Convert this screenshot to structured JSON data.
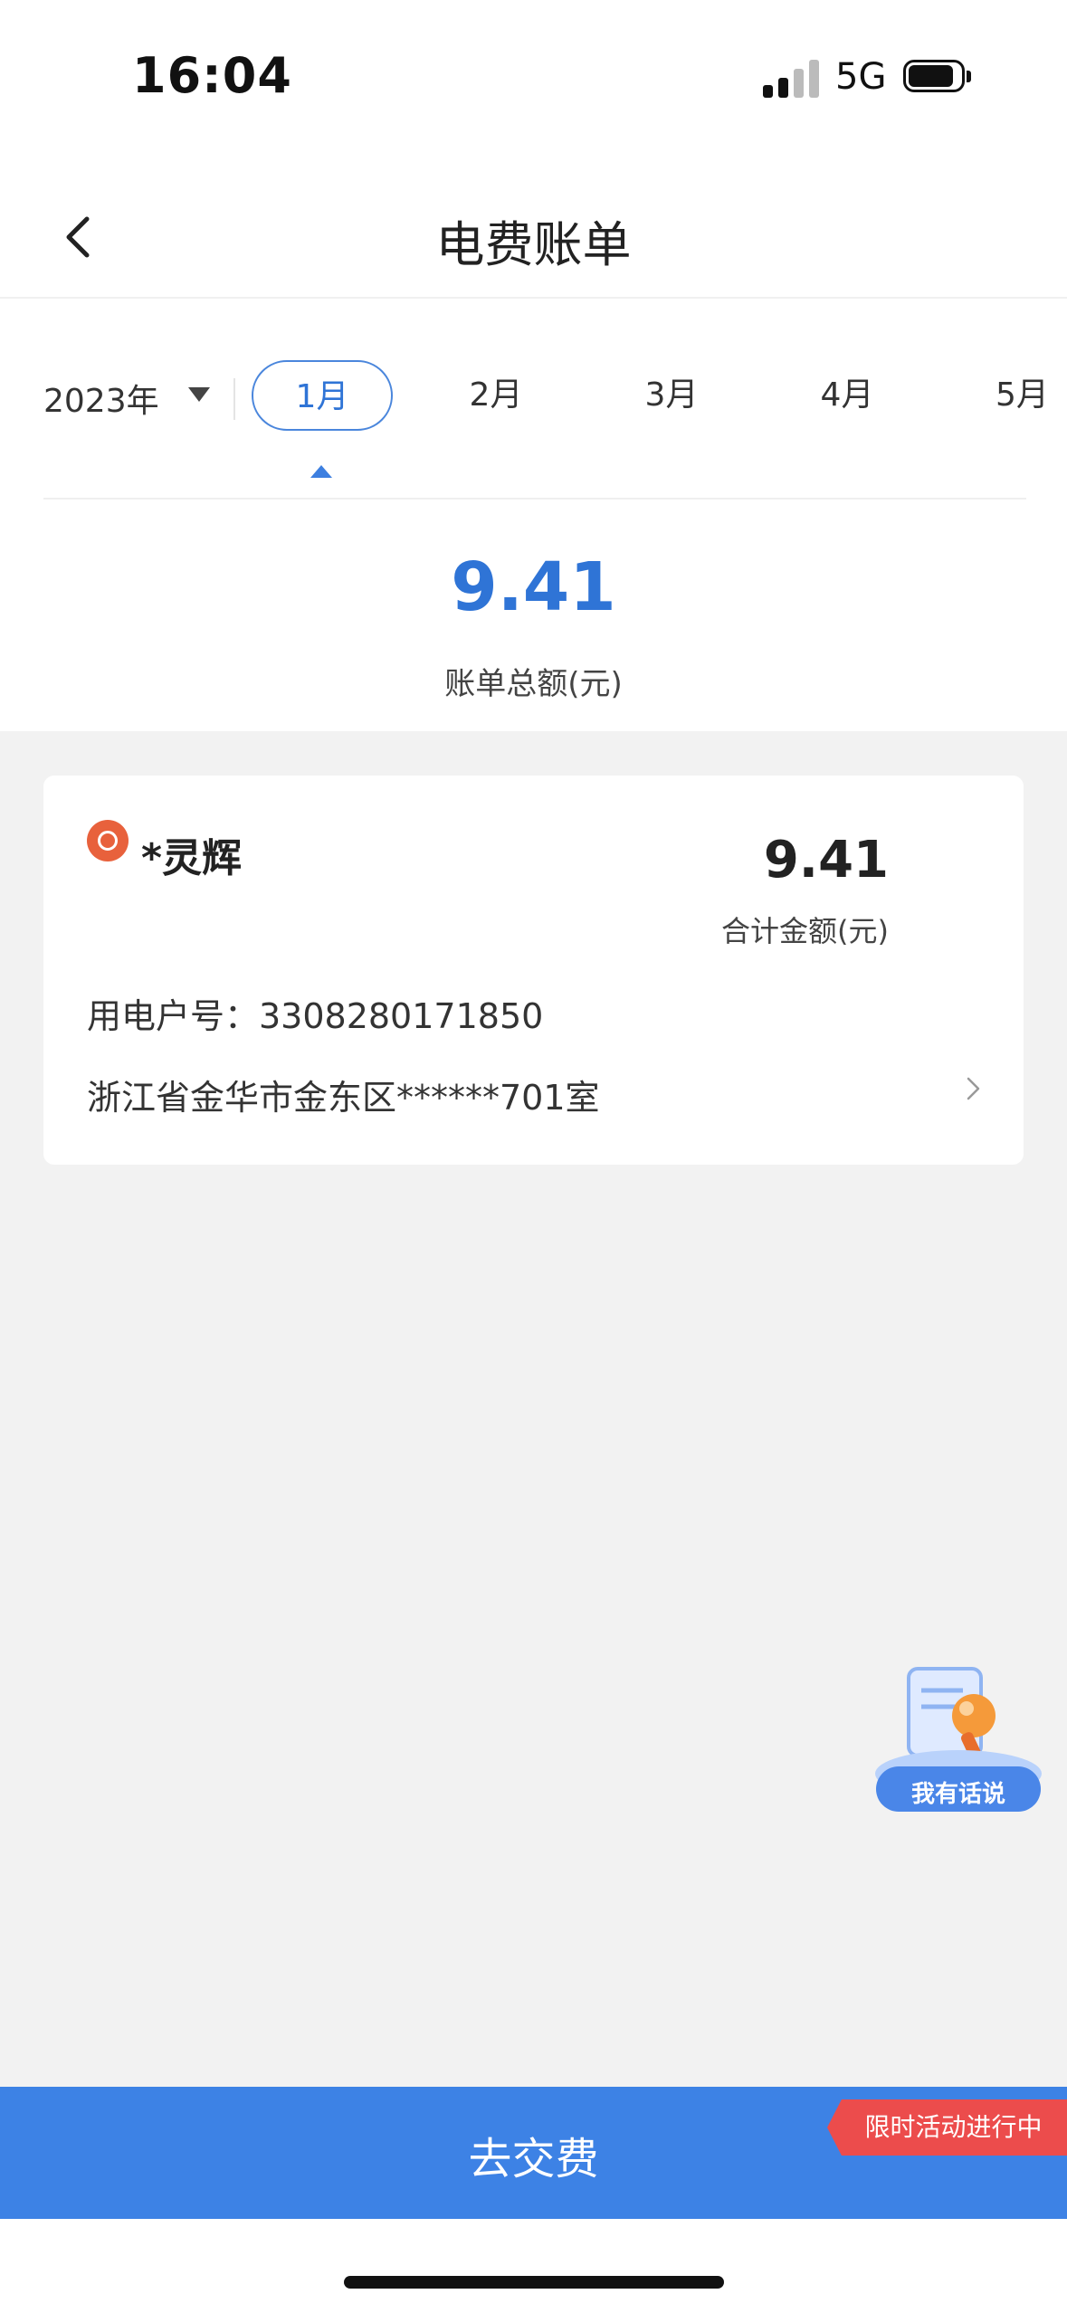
{
  "status_bar": {
    "time": "16:04",
    "network": "5G"
  },
  "header": {
    "title": "电费账单"
  },
  "month_selector": {
    "year": "2023年",
    "months": [
      "1月",
      "2月",
      "3月",
      "4月",
      "5月"
    ],
    "active_index": 0
  },
  "summary": {
    "total": "9.41",
    "total_label": "账单总额(元)"
  },
  "account_card": {
    "name": "*灵辉",
    "amount": "9.41",
    "amount_label": "合计金额(元)",
    "account_number": "用电户号：3308280171850",
    "address": "浙江省金华市金东区******701室"
  },
  "feedback": {
    "label": "我有话说"
  },
  "pay_bar": {
    "label": "去交费",
    "promo": "限时活动进行中"
  },
  "colors": {
    "accent": "#2f74d6",
    "pay_bar": "#3d82e5",
    "promo": "#ec4c4c",
    "logo": "#e8613c"
  }
}
